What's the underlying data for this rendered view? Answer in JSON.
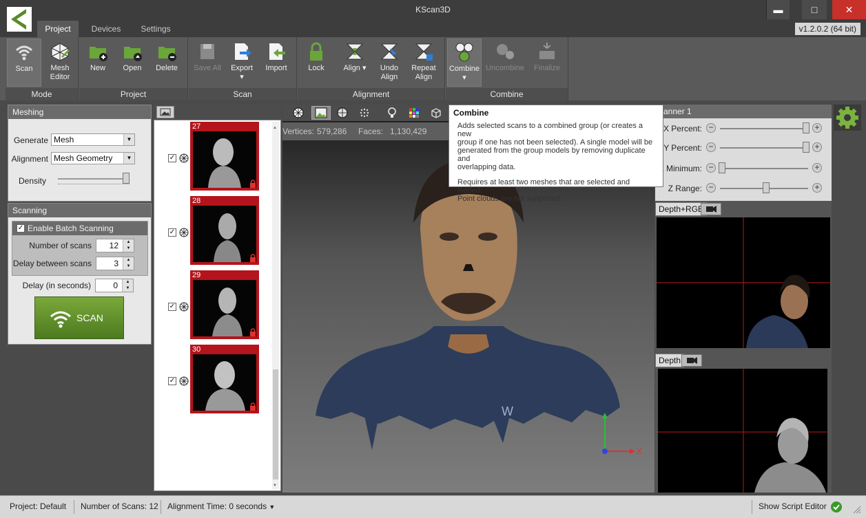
{
  "window": {
    "title": "KScan3D",
    "version": "v1.2.0.2  (64 bit)"
  },
  "tabs": [
    {
      "label": "Project"
    },
    {
      "label": "Devices"
    },
    {
      "label": "Settings"
    }
  ],
  "ribbon": {
    "mode": {
      "label": "Mode",
      "scan": "Scan",
      "mesh_editor_1": "Mesh",
      "mesh_editor_2": "Editor"
    },
    "project": {
      "label": "Project",
      "new": "New",
      "open": "Open",
      "delete": "Delete"
    },
    "scan": {
      "label": "Scan",
      "save_all": "Save All",
      "export": "Export",
      "import": "Import"
    },
    "alignment": {
      "label": "Alignment",
      "lock": "Lock",
      "align": "Align",
      "undo_align_1": "Undo",
      "undo_align_2": "Align",
      "repeat_align_1": "Repeat",
      "repeat_align_2": "Align"
    },
    "combine": {
      "label": "Combine",
      "combine": "Combine",
      "uncombine": "Uncombine",
      "finalize": "Finalize"
    }
  },
  "meshing": {
    "title": "Meshing",
    "generate_label": "Generate",
    "generate_value": "Mesh",
    "alignment_label": "Alignment",
    "alignment_value": "Mesh Geometry",
    "density_label": "Density"
  },
  "scanning": {
    "title": "Scanning",
    "batch_label": "Enable Batch Scanning",
    "num_scans_label": "Number of scans",
    "num_scans_value": "12",
    "delay_between_label": "Delay between scans",
    "delay_between_value": "3",
    "delay_label": "Delay (in seconds)",
    "delay_value": "0",
    "scan_button": "SCAN"
  },
  "scans": [
    {
      "num": "27"
    },
    {
      "num": "28"
    },
    {
      "num": "29"
    },
    {
      "num": "30"
    }
  ],
  "viewport": {
    "vertices_label": "Vertices:",
    "vertices_value": "579,286",
    "faces_label": "Faces:",
    "faces_value": "1,130,429",
    "axis_x": "X",
    "watermark": "W"
  },
  "tooltip": {
    "title": "Combine",
    "p1_l1": "Adds selected scans to a combined group (or creates a new",
    "p1_l2": "group if one has not been selected).  A single model will be",
    "p1_l3": "generated from the group models by removing duplicate and",
    "p1_l4": "overlapping data.",
    "p2_l1": "Requires at least two meshes that are selected and loaded.",
    "p2_l2": "Point clouds are not supported."
  },
  "scanner": {
    "title": "canner 1",
    "x_percent": "X Percent:",
    "y_percent": "Y Percent:",
    "z_minimum": "Z Minimum:",
    "z_range": "Z Range:",
    "feed1_tab": "Depth+RGB",
    "feed2_tab": "Depth"
  },
  "status": {
    "project": "Project:  Default",
    "num_scans": "Number of Scans:  12",
    "alignment_time": "Alignment Time:  0 seconds",
    "script_editor": "Show Script Editor"
  },
  "colors": {
    "accent_green": "#5a8a2a",
    "close_red": "#c8302a",
    "thumb_red": "#b4141b"
  }
}
